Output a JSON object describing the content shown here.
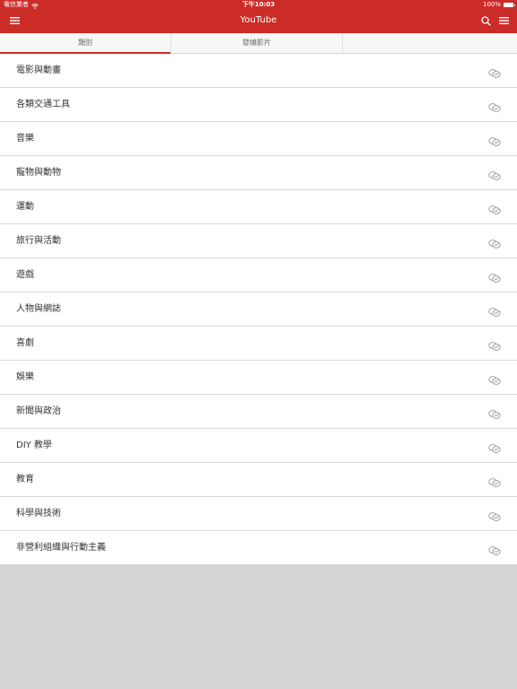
{
  "status_bar": {
    "carrier": "電信業者",
    "time": "下午10:03",
    "battery": "100%"
  },
  "nav": {
    "title": "YouTube",
    "menu_icon": "hamburger-icon",
    "search_icon": "search-icon",
    "options_icon": "list-menu-icon"
  },
  "tabs": [
    {
      "label": "類別"
    },
    {
      "label": "發燒影片"
    },
    {
      "label": ""
    }
  ],
  "categories": [
    {
      "label": "電影與動畫"
    },
    {
      "label": "各類交通工具"
    },
    {
      "label": "音樂"
    },
    {
      "label": "寵物與動物"
    },
    {
      "label": "運動"
    },
    {
      "label": "旅行與活動"
    },
    {
      "label": "遊戲"
    },
    {
      "label": "人物與網誌"
    },
    {
      "label": "喜劇"
    },
    {
      "label": "娛樂"
    },
    {
      "label": "新聞與政治"
    },
    {
      "label": "DIY 教學"
    },
    {
      "label": "教育"
    },
    {
      "label": "科學與技術"
    },
    {
      "label": "非營利組織與行動主義"
    }
  ],
  "colors": {
    "accent": "#cc2c28",
    "background": "#d6d6d6",
    "row_bg": "#ffffff",
    "divider": "#d8d8d8"
  }
}
